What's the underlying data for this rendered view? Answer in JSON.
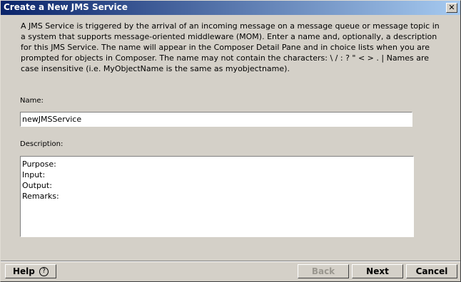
{
  "window": {
    "title": "Create a New JMS Service",
    "close_label": "✕"
  },
  "intro": {
    "lines": [
      "A JMS Service is triggered by the arrival of an incoming message on a message queue or message topic in",
      "a system that supports message-oriented middleware (MOM).  Enter a name and, optionally, a description",
      "for this JMS Service.  The name will appear in the Composer Detail Pane and in choice lists when you are",
      "prompted for objects in Composer.  The name may not contain the characters: \\  /  :  ?   \"  <  >  .  |  Names are",
      "case insensitive (i.e. MyObjectName is the same as myobjectname)."
    ]
  },
  "name_field": {
    "label": "Name:",
    "value": "newJMSService"
  },
  "description_field": {
    "label": "Description:",
    "lines": [
      "Purpose:",
      "Input:",
      "Output:",
      "Remarks:"
    ]
  },
  "buttons": {
    "help": "Help",
    "help_icon": "?",
    "back": "Back",
    "next": "Next",
    "cancel": "Cancel"
  }
}
